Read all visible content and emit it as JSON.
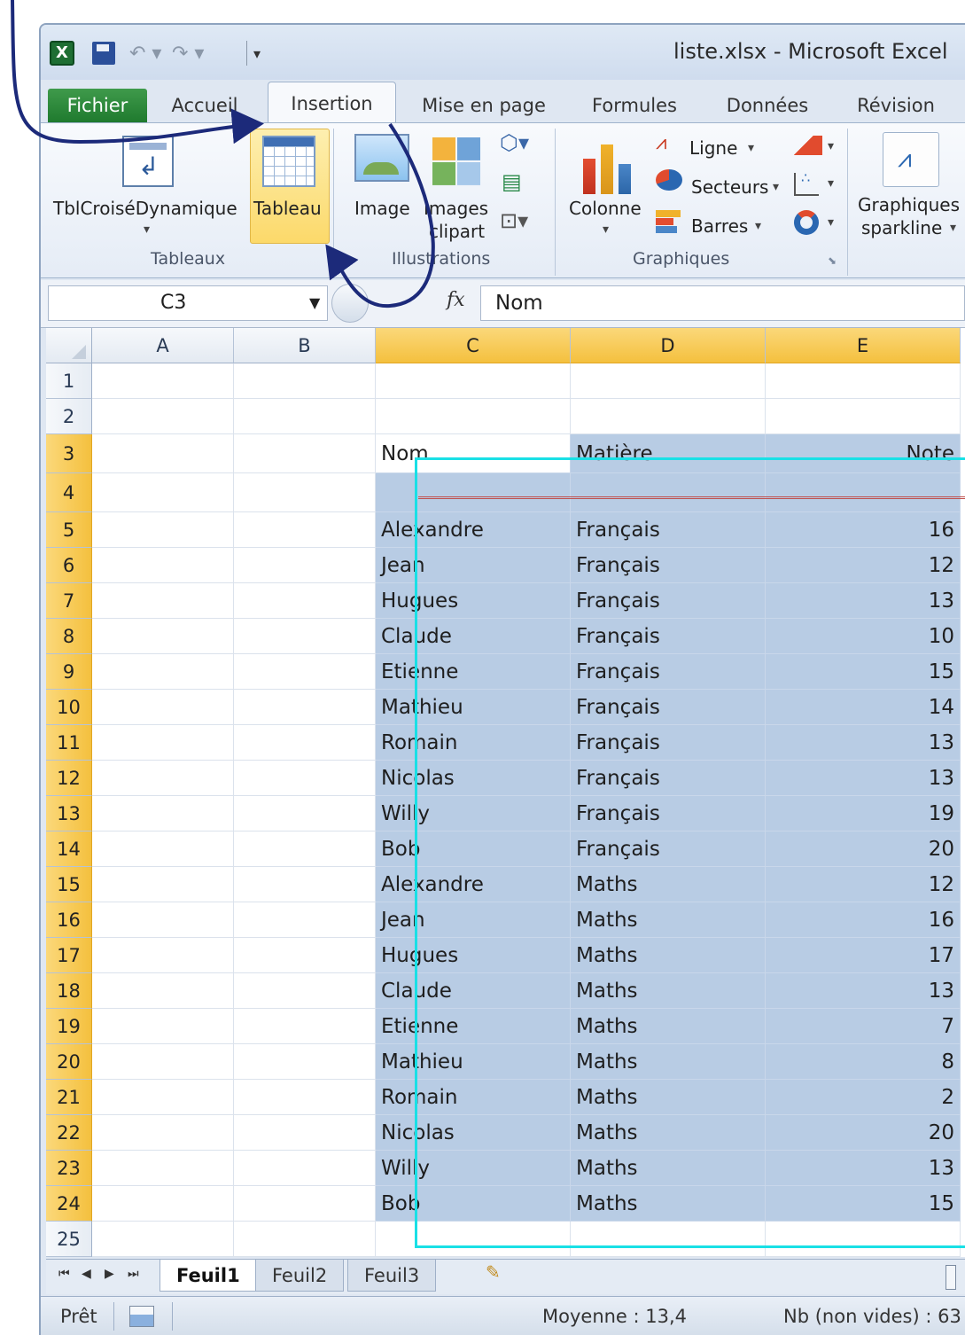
{
  "window": {
    "title": "liste.xlsx - Microsoft Excel",
    "logo_text": "X",
    "qat_undo": "↶ ▾",
    "qat_redo": "↷ ▾",
    "qat_customize": "▾"
  },
  "tabs": {
    "fichier": "Fichier",
    "accueil": "Accueil",
    "insertion": "Insertion",
    "mise_en_page": "Mise en page",
    "formules": "Formules",
    "donnees": "Données",
    "revision": "Révision"
  },
  "ribbon": {
    "tableaux": {
      "label": "Tableaux",
      "tcd": "TblCroiséDynamique",
      "tableau": "Tableau"
    },
    "illustrations": {
      "label": "Illustrations",
      "image": "Image",
      "images_line1": "Images",
      "images_line2": "clipart"
    },
    "graphiques": {
      "label": "Graphiques",
      "colonne": "Colonne",
      "ligne": "Ligne",
      "secteurs": "Secteurs",
      "barres": "Barres"
    },
    "sparkline": {
      "line1": "Graphiques",
      "line2": "sparkline"
    }
  },
  "formula_bar": {
    "name_box": "C3",
    "fx": "fx",
    "content": "Nom"
  },
  "columns": [
    "A",
    "B",
    "C",
    "D",
    "E"
  ],
  "rows": [
    {
      "n": "1",
      "c": "",
      "d": "",
      "e": ""
    },
    {
      "n": "2",
      "c": "",
      "d": "",
      "e": ""
    },
    {
      "n": "3",
      "c": "Nom",
      "d": "Matière",
      "e": "Note"
    },
    {
      "n": "4",
      "c": "",
      "d": "",
      "e": ""
    },
    {
      "n": "5",
      "c": "Alexandre",
      "d": "Français",
      "e": "16"
    },
    {
      "n": "6",
      "c": "Jean",
      "d": "Français",
      "e": "12"
    },
    {
      "n": "7",
      "c": "Hugues",
      "d": "Français",
      "e": "13"
    },
    {
      "n": "8",
      "c": "Claude",
      "d": "Français",
      "e": "10"
    },
    {
      "n": "9",
      "c": "Etienne",
      "d": "Français",
      "e": "15"
    },
    {
      "n": "10",
      "c": "Mathieu",
      "d": "Français",
      "e": "14"
    },
    {
      "n": "11",
      "c": "Romain",
      "d": "Français",
      "e": "13"
    },
    {
      "n": "12",
      "c": "Nicolas",
      "d": "Français",
      "e": "13"
    },
    {
      "n": "13",
      "c": "Willy",
      "d": "Français",
      "e": "19"
    },
    {
      "n": "14",
      "c": "Bob",
      "d": "Français",
      "e": "20"
    },
    {
      "n": "15",
      "c": "Alexandre",
      "d": "Maths",
      "e": "12"
    },
    {
      "n": "16",
      "c": "Jean",
      "d": "Maths",
      "e": "16"
    },
    {
      "n": "17",
      "c": "Hugues",
      "d": "Maths",
      "e": "17"
    },
    {
      "n": "18",
      "c": "Claude",
      "d": "Maths",
      "e": "13"
    },
    {
      "n": "19",
      "c": "Etienne",
      "d": "Maths",
      "e": "7"
    },
    {
      "n": "20",
      "c": "Mathieu",
      "d": "Maths",
      "e": "8"
    },
    {
      "n": "21",
      "c": "Romain",
      "d": "Maths",
      "e": "2"
    },
    {
      "n": "22",
      "c": "Nicolas",
      "d": "Maths",
      "e": "20"
    },
    {
      "n": "23",
      "c": "Willy",
      "d": "Maths",
      "e": "13"
    },
    {
      "n": "24",
      "c": "Bob",
      "d": "Maths",
      "e": "15"
    },
    {
      "n": "25",
      "c": "",
      "d": "",
      "e": ""
    }
  ],
  "sheets": {
    "nav": [
      "⏮",
      "◀",
      "▶",
      "⏭"
    ],
    "tabs": [
      "Feuil1",
      "Feuil2",
      "Feuil3"
    ],
    "active": "Feuil1"
  },
  "status": {
    "ready": "Prêt",
    "average": "Moyenne : 13,4",
    "count": "Nb (non vides) : 63"
  },
  "colors": {
    "selection_outline": "#19e0e6",
    "table_fill": "#b8cce4",
    "annotation_arrow": "#1c2a7a",
    "fichier_tab": "#1f7a2e"
  }
}
